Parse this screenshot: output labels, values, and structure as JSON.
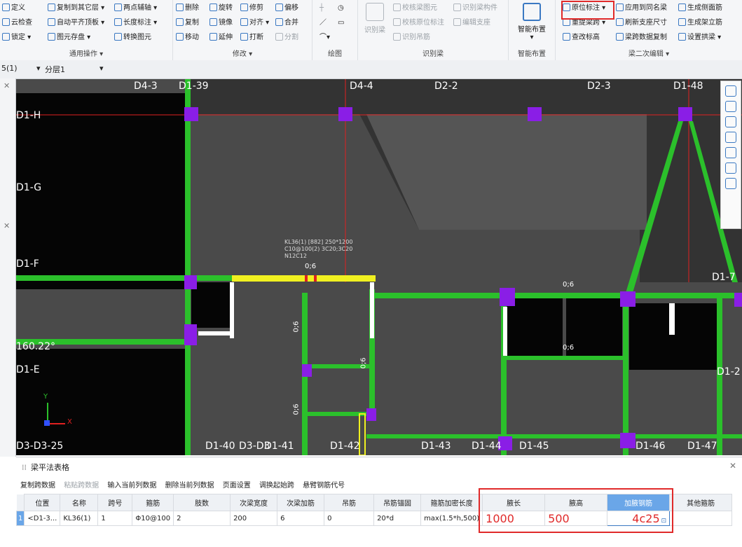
{
  "ribbon": {
    "groups": {
      "general": {
        "title": "通用操作 ▾",
        "items": [
          "定义",
          "复制到其它层 ▾",
          "两点辅轴 ▾",
          "云检查",
          "自动平齐顶板 ▾",
          "长度标注 ▾",
          "锁定 ▾",
          "图元存盘 ▾",
          "转换图元"
        ]
      },
      "modify": {
        "title": "修改 ▾",
        "items": [
          "删除",
          "旋转",
          "修剪",
          "偏移",
          "复制",
          "镜像",
          "对齐 ▾",
          "合并",
          "移动",
          "延伸",
          "打断",
          "分割"
        ]
      },
      "draw": {
        "title": "绘图"
      },
      "identify": {
        "title": "识别梁",
        "main": "识别梁",
        "items": [
          "校核梁图元",
          "识别梁构件",
          "校核原位标注",
          "编辑支座",
          "识别吊筋"
        ]
      },
      "smart": {
        "title": "智能布置",
        "main": "智能布置"
      },
      "beam2": {
        "title": "梁二次编辑 ▾",
        "items": [
          "原位标注 ▾",
          "应用到同名梁",
          "生成侧面筋",
          "重提梁跨 ▾",
          "刷新支座尺寸",
          "生成架立筋",
          "查改标高",
          "梁跨数据复制",
          "设置拱梁 ▾"
        ]
      }
    }
  },
  "layer": {
    "floor": "5(1)",
    "sublayer": "分层1"
  },
  "canvas": {
    "axis_labels": [
      "D4-3",
      "D1-39",
      "D4-4",
      "D2-2",
      "D2-3",
      "D1-48",
      "D1-H",
      "D1-G",
      "D1-F",
      "D1-E",
      "D1-7",
      "D1-2",
      "D3-D3-25",
      "D1-40",
      "D3-D3",
      "D1-41",
      "D1-42",
      "D1-43",
      "D1-44",
      "D1-45",
      "D1-46",
      "D1-47"
    ],
    "angle": "160.22°",
    "beam_annotation": [
      "KL36(1) [882] 250*1200",
      "C10@100(2) 3C20;3C20",
      "N12C12"
    ],
    "span_labels": [
      "0;6",
      "0;6",
      "0;6",
      "0;6",
      "0;6",
      "0;6"
    ]
  },
  "panel": {
    "title": "梁平法表格",
    "toolbar": [
      "复制跨数据",
      "粘贴跨数据",
      "输入当前列数据",
      "删除当前列数据",
      "页面设置",
      "调换起始跨",
      "悬臂钢筋代号"
    ],
    "columns": [
      "位置",
      "名称",
      "跨号",
      "箍筋",
      "肢数",
      "次梁宽度",
      "次梁加筋",
      "吊筋",
      "吊筋锚固",
      "箍筋加密长度",
      "腋长",
      "腋高",
      "加腋钢筋",
      "其他箍筋"
    ],
    "row": {
      "index": "1",
      "position": "<D1-3...",
      "name": "KL36(1)",
      "span": "1",
      "stirrup": "Φ10@100",
      "legs": "2",
      "sub_width": "200",
      "sub_add": "6",
      "hanger": "0",
      "hanger_anchor": "20*d",
      "dense_len": "max(1.5*h,500)",
      "haunch_len": "1000",
      "haunch_height": "500",
      "haunch_bar": "4c25"
    }
  }
}
